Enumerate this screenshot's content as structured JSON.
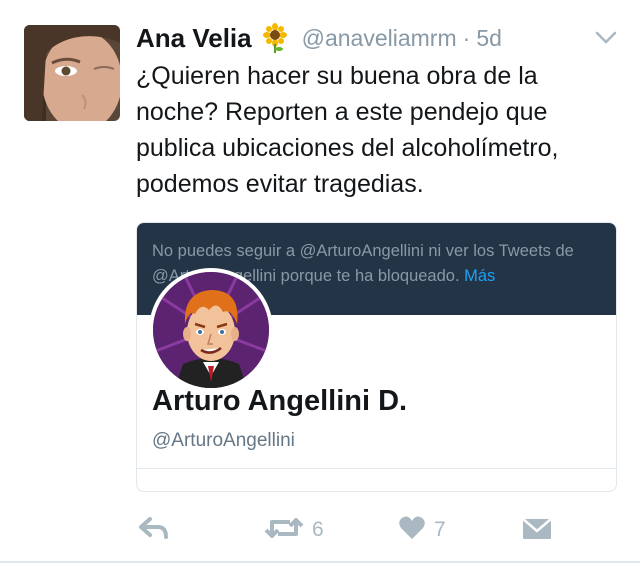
{
  "tweet": {
    "author_name": "Ana Velia",
    "author_emoji": "sunflower-icon",
    "handle": "@anaveliamrm",
    "separator": "·",
    "time": "5d",
    "text": "¿Quieren hacer su buena obra de la noche? Reporten a este pendejo que publica ubicaciones del alcoholímetro, podemos evitar tragedias."
  },
  "card": {
    "blocked_message": "No puedes seguir a @ArturoAngellini ni ver los Tweets de @ArturoAngellini porque te ha bloqueado.",
    "more_link": "Más",
    "profile_name": "Arturo Angellini D.",
    "profile_handle": "@ArturoAngellini",
    "banner_color": "#243447"
  },
  "actions": {
    "reply_icon": "reply-icon",
    "retweet_icon": "retweet-icon",
    "retweet_count": "6",
    "like_icon": "heart-icon",
    "like_count": "7",
    "dm_icon": "envelope-icon"
  },
  "colors": {
    "text": "#14171a",
    "muted": "#8899a6",
    "link": "#1da1f2",
    "icon": "#aab8c2"
  }
}
